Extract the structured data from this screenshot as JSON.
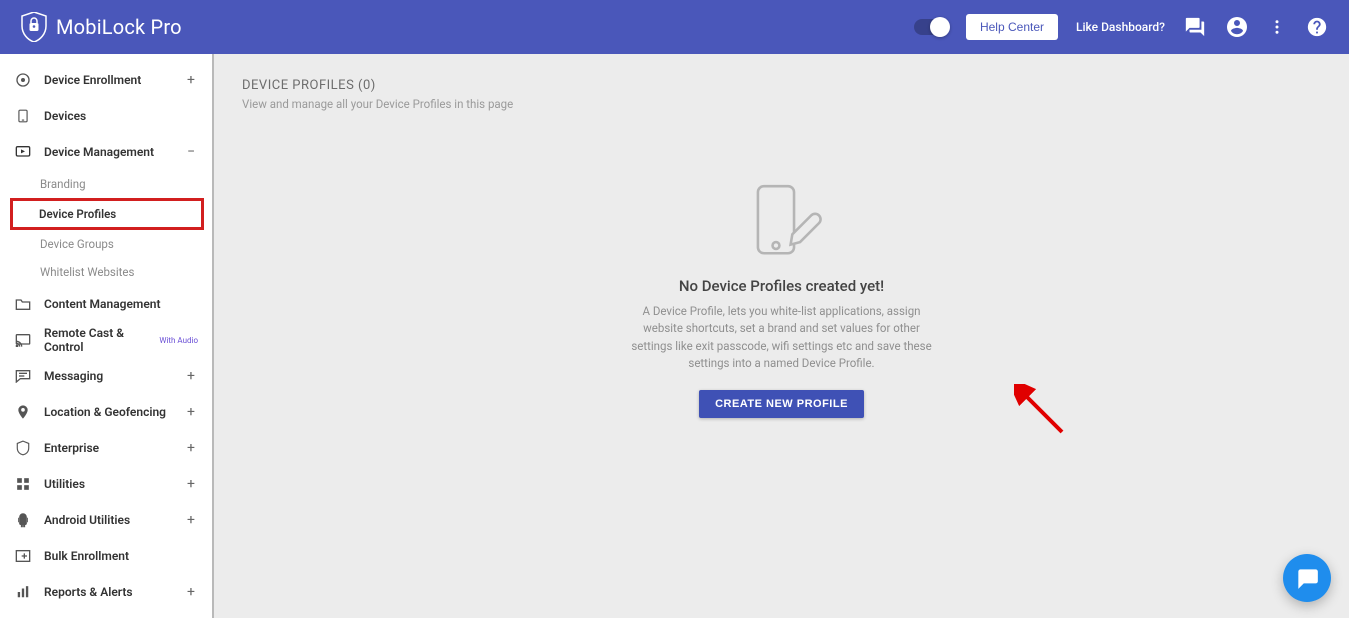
{
  "header": {
    "product_name": "MobiLock Pro",
    "help_center": "Help Center",
    "like_dashboard": "Like Dashboard?"
  },
  "sidebar": {
    "items": [
      {
        "label": "Device Enrollment",
        "expander": "+"
      },
      {
        "label": "Devices",
        "expander": ""
      },
      {
        "label": "Device Management",
        "expander": "−"
      },
      {
        "label": "Content Management",
        "expander": ""
      },
      {
        "label": "Remote Cast & Control",
        "expander": "",
        "badge": "With Audio"
      },
      {
        "label": "Messaging",
        "expander": "+"
      },
      {
        "label": "Location & Geofencing",
        "expander": "+"
      },
      {
        "label": "Enterprise",
        "expander": "+"
      },
      {
        "label": "Utilities",
        "expander": "+"
      },
      {
        "label": "Android Utilities",
        "expander": "+"
      },
      {
        "label": "Bulk Enrollment",
        "expander": ""
      },
      {
        "label": "Reports & Alerts",
        "expander": "+"
      }
    ],
    "device_mgmt_children": [
      {
        "label": "Branding"
      },
      {
        "label": "Device Profiles"
      },
      {
        "label": "Device Groups"
      },
      {
        "label": "Whitelist Websites"
      }
    ]
  },
  "page": {
    "title": "DEVICE PROFILES (0)",
    "subtitle": "View and manage all your Device Profiles in this page",
    "empty_title": "No Device Profiles created yet!",
    "empty_desc": "A Device Profile, lets you white-list applications, assign website shortcuts, set a brand and set values for other settings like exit passcode, wifi settings etc and save these settings into a named Device Profile.",
    "cta": "CREATE NEW PROFILE"
  }
}
